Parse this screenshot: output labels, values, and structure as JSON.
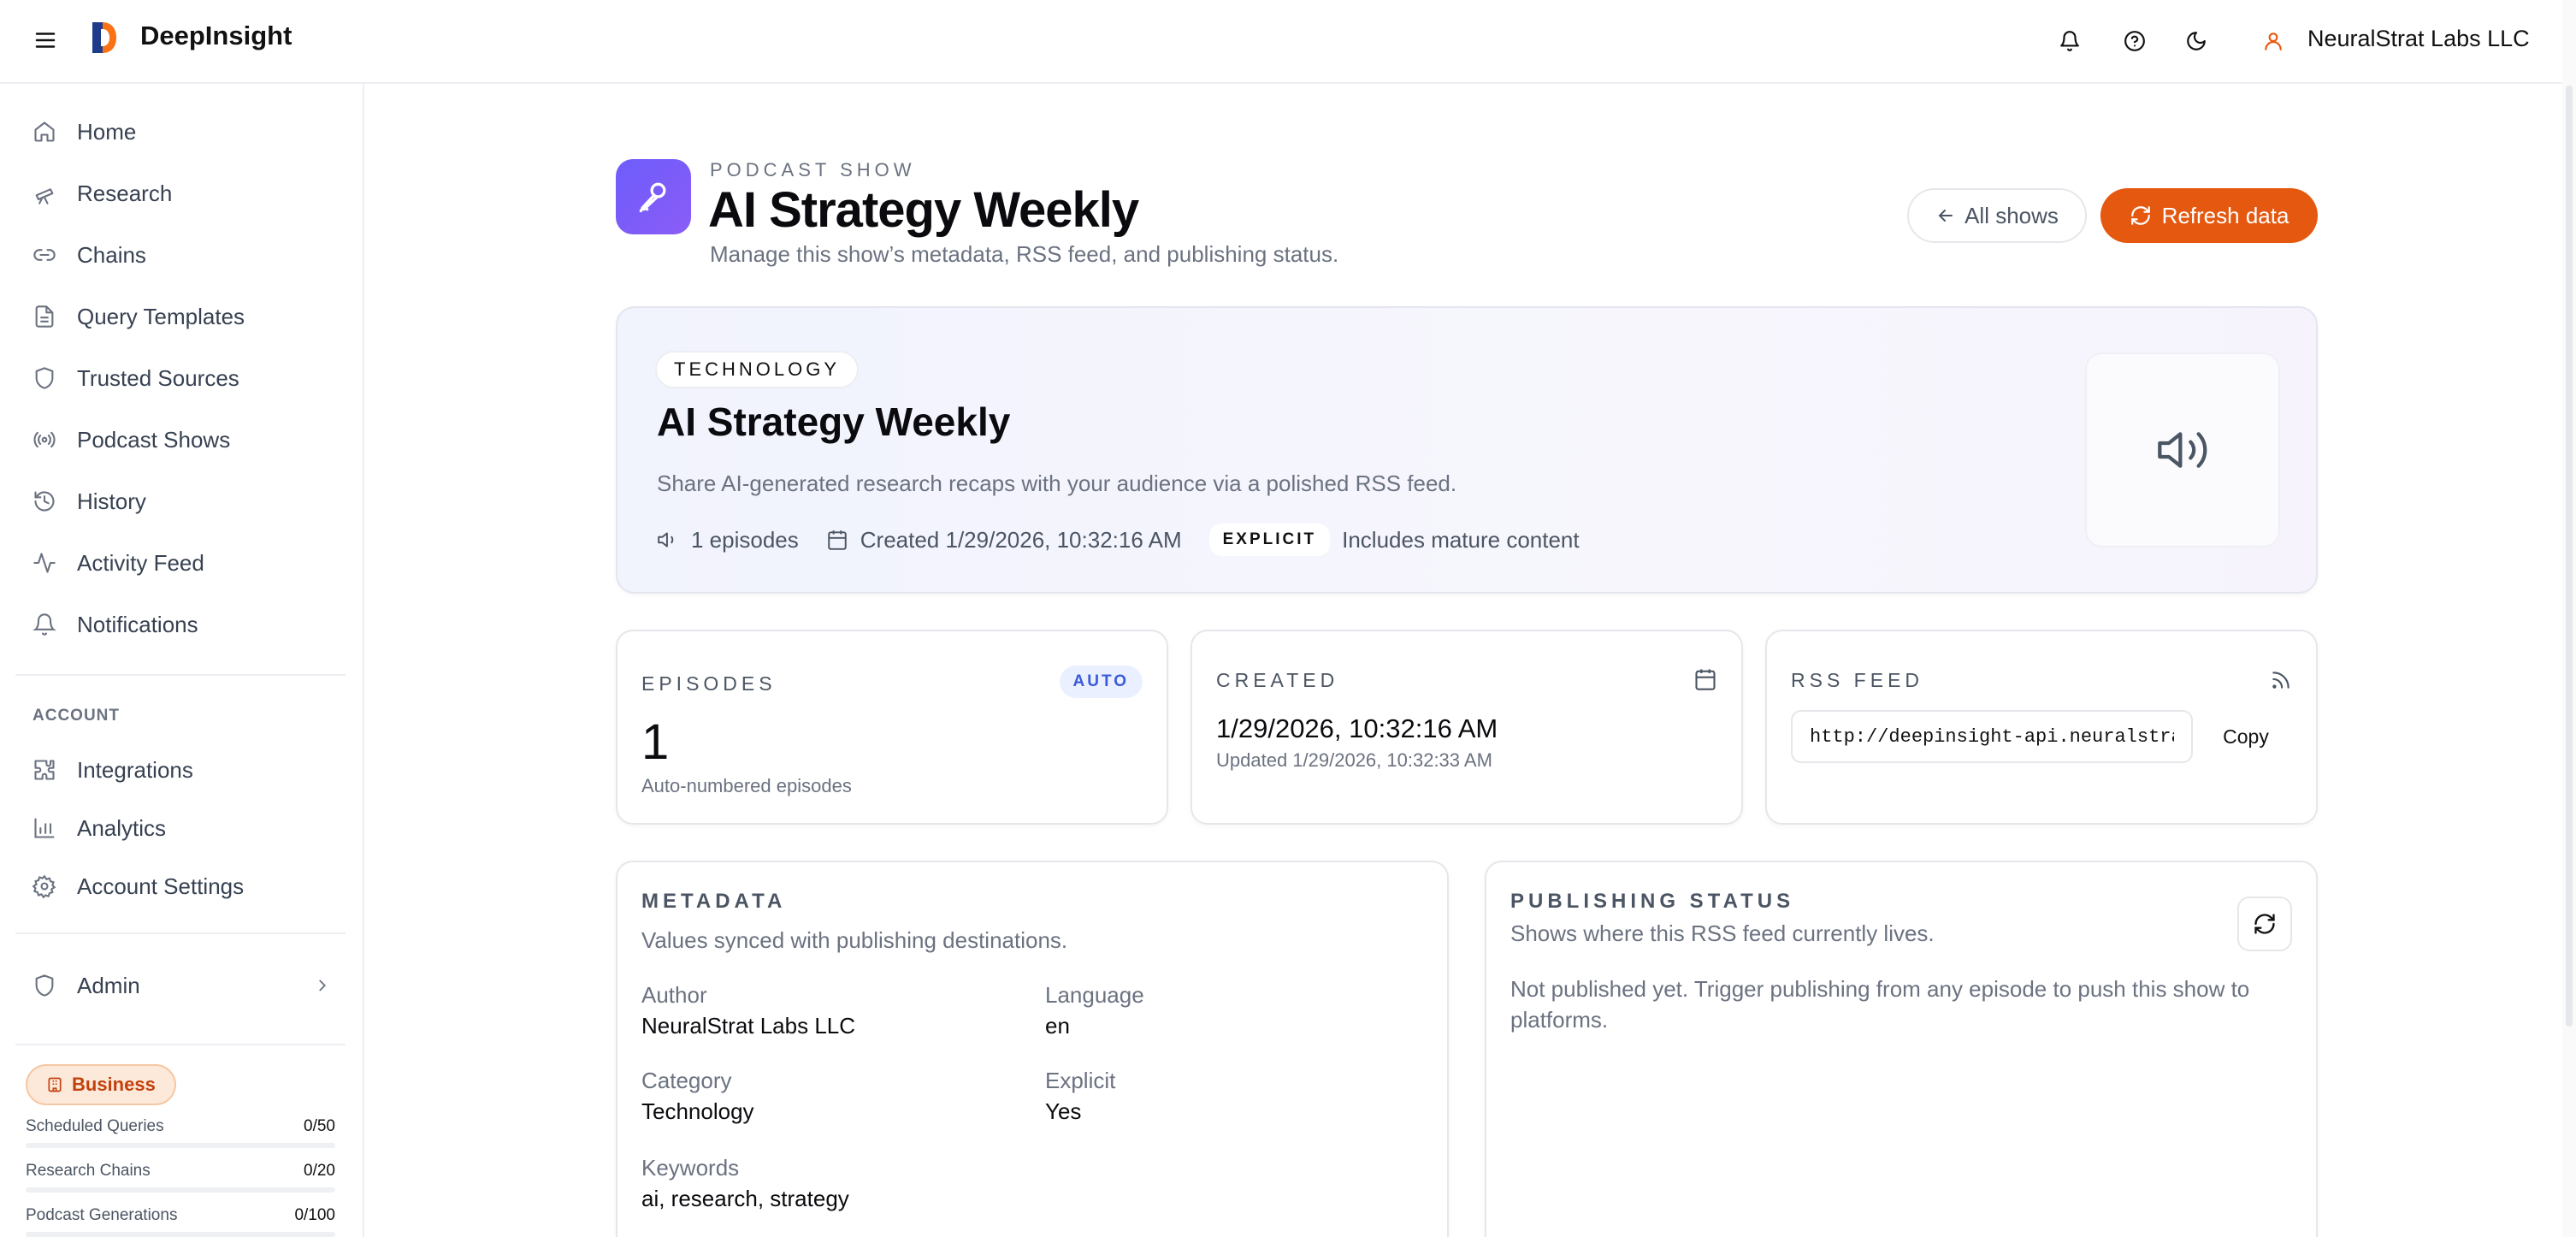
{
  "app": {
    "brand": "DeepInsight",
    "org": "NeuralStrat Labs LLC"
  },
  "topbar": {
    "icons": [
      "menu-icon",
      "bell-icon",
      "help-icon",
      "moon-icon",
      "user-icon"
    ]
  },
  "sidebar": {
    "items": [
      {
        "label": "Home",
        "icon": "home-icon"
      },
      {
        "label": "Research",
        "icon": "telescope-icon"
      },
      {
        "label": "Chains",
        "icon": "link-icon"
      },
      {
        "label": "Query Templates",
        "icon": "file-icon"
      },
      {
        "label": "Trusted Sources",
        "icon": "shield-icon"
      },
      {
        "label": "Podcast Shows",
        "icon": "broadcast-icon"
      },
      {
        "label": "History",
        "icon": "history-icon"
      },
      {
        "label": "Activity Feed",
        "icon": "activity-icon"
      },
      {
        "label": "Notifications",
        "icon": "bell-icon"
      }
    ],
    "account_section": "ACCOUNT",
    "account_items": [
      {
        "label": "Integrations",
        "icon": "puzzle-icon"
      },
      {
        "label": "Analytics",
        "icon": "bar-chart-icon"
      },
      {
        "label": "Account Settings",
        "icon": "gear-icon"
      }
    ],
    "admin": {
      "label": "Admin"
    },
    "plan": "Business",
    "usage": [
      {
        "label": "Scheduled Queries",
        "value": "0/50",
        "fraction": 0
      },
      {
        "label": "Research Chains",
        "value": "0/20",
        "fraction": 0
      },
      {
        "label": "Podcast Generations",
        "value": "0/100",
        "fraction": 0
      }
    ]
  },
  "header": {
    "eyebrow": "PODCAST SHOW",
    "title": "AI Strategy Weekly",
    "subtitle": "Manage this show’s metadata, RSS feed, and publishing status.",
    "all_shows": "All shows",
    "refresh": "Refresh data"
  },
  "hero": {
    "tag": "TECHNOLOGY",
    "title": "AI Strategy Weekly",
    "description": "Share AI-generated research recaps with your audience via a polished RSS feed.",
    "episodes": "1 episodes",
    "created": "Created 1/29/2026, 10:32:16 AM",
    "explicit_badge": "EXPLICIT",
    "explicit_note": "Includes mature content"
  },
  "stats": {
    "episodes": {
      "label": "EPISODES",
      "badge": "AUTO",
      "value": "1",
      "note": "Auto-numbered episodes"
    },
    "created": {
      "label": "CREATED",
      "value": "1/29/2026, 10:32:16 AM",
      "note": "Updated 1/29/2026, 10:32:33 AM"
    },
    "rss": {
      "label": "RSS FEED",
      "url": "http://deepinsight-api.neuralstra",
      "copy": "Copy"
    }
  },
  "metadata": {
    "title": "METADATA",
    "subtitle": "Values synced with publishing destinations.",
    "author_label": "Author",
    "author": "NeuralStrat Labs LLC",
    "language_label": "Language",
    "language": "en",
    "category_label": "Category",
    "category": "Technology",
    "explicit_label": "Explicit",
    "explicit": "Yes",
    "keywords_label": "Keywords",
    "keywords": "ai, research, strategy"
  },
  "publishing": {
    "title": "PUBLISHING STATUS",
    "subtitle": "Shows where this RSS feed currently lives.",
    "status": "Not published yet. Trigger publishing from any episode to push this show to platforms."
  },
  "colors": {
    "accent": "#e5580f",
    "brand_purple": "#7c5cf6",
    "link_blue": "#3b5bdb"
  }
}
